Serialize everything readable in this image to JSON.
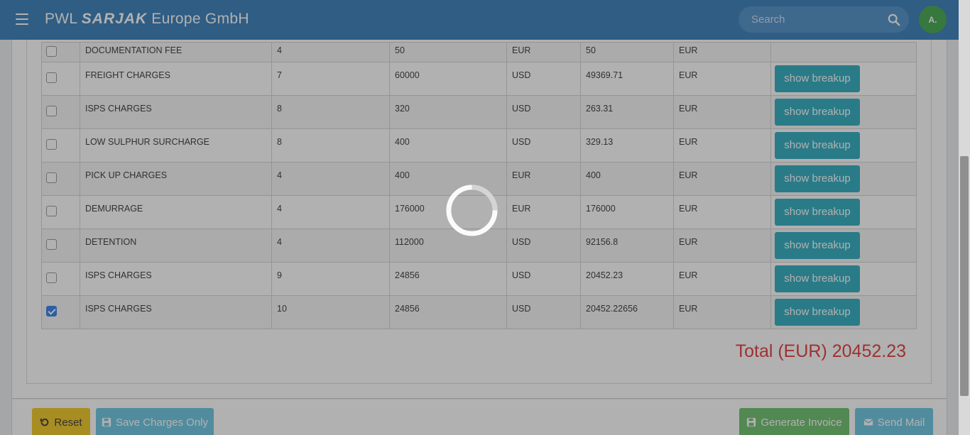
{
  "header": {
    "brand_prefix": "PWL",
    "brand_bold": "SARJAK",
    "brand_suffix": "Europe GmbH",
    "search_placeholder": "Search",
    "avatar_initials": "A."
  },
  "charges": [
    {
      "checked": false,
      "name": "DOCUMENTATION FEE",
      "qty": "4",
      "rate": "50",
      "currency": "EUR",
      "amount": "50",
      "amount_currency": "EUR",
      "action": ""
    },
    {
      "checked": false,
      "name": "FREIGHT CHARGES",
      "qty": "7",
      "rate": "60000",
      "currency": "USD",
      "amount": "49369.71",
      "amount_currency": "EUR",
      "action": "show breakup"
    },
    {
      "checked": false,
      "name": "ISPS CHARGES",
      "qty": "8",
      "rate": "320",
      "currency": "USD",
      "amount": "263.31",
      "amount_currency": "EUR",
      "action": "show breakup"
    },
    {
      "checked": false,
      "name": "LOW SULPHUR SURCHARGE",
      "qty": "8",
      "rate": "400",
      "currency": "USD",
      "amount": "329.13",
      "amount_currency": "EUR",
      "action": "show breakup"
    },
    {
      "checked": false,
      "name": "PICK UP CHARGES",
      "qty": "4",
      "rate": "400",
      "currency": "EUR",
      "amount": "400",
      "amount_currency": "EUR",
      "action": "show breakup"
    },
    {
      "checked": false,
      "name": "DEMURRAGE",
      "qty": "4",
      "rate": "176000",
      "currency": "EUR",
      "amount": "176000",
      "amount_currency": "EUR",
      "action": "show breakup"
    },
    {
      "checked": false,
      "name": "DETENTION",
      "qty": "4",
      "rate": "112000",
      "currency": "USD",
      "amount": "92156.8",
      "amount_currency": "EUR",
      "action": "show breakup"
    },
    {
      "checked": false,
      "name": "ISPS CHARGES",
      "qty": "9",
      "rate": "24856",
      "currency": "USD",
      "amount": "20452.23",
      "amount_currency": "EUR",
      "action": "show breakup"
    },
    {
      "checked": true,
      "name": "ISPS CHARGES",
      "qty": "10",
      "rate": "24856",
      "currency": "USD",
      "amount": "20452.22656",
      "amount_currency": "EUR",
      "action": "show breakup"
    }
  ],
  "total": "Total (EUR) 20452.23",
  "footer": {
    "reset_label": "Reset",
    "save_label": "Save Charges Only",
    "generate_label": "Generate Invoice",
    "mail_label": "Send Mail"
  },
  "colors": {
    "header_bg": "#1f6fb2",
    "breakup_button": "#17a2b8",
    "total_text": "#e02424",
    "reset_button": "#f0c20a",
    "save_button": "#5bc0de",
    "generate_button": "#5cb85c",
    "mail_button": "#5bc0de"
  },
  "overlay": {
    "loading": true
  }
}
